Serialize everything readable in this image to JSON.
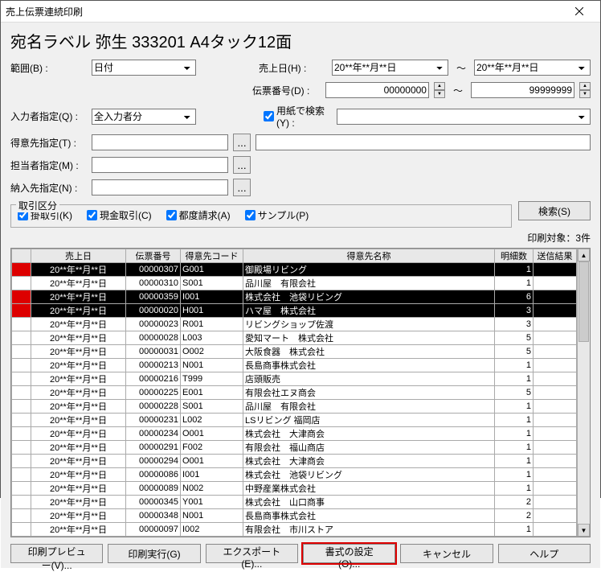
{
  "title": "売上伝票連続印刷",
  "heading": "宛名ラベル 弥生 333201 A4タック12面",
  "labels": {
    "range": "範囲(B) :",
    "saleDate": "売上日(H) :",
    "slipNo": "伝票番号(D) :",
    "inputter": "入力者指定(Q) :",
    "paperSearch": "用紙で検索(Y) :",
    "customer": "得意先指定(T) :",
    "person": "担当者指定(M) :",
    "delivery": "納入先指定(N) :"
  },
  "values": {
    "range": "日付",
    "dateFrom": "20**年**月**日",
    "dateTo": "20**年**月**日",
    "slipFrom": "00000000",
    "slipTo": "99999999",
    "inputter": "全入力者分"
  },
  "fieldset": {
    "legend": "取引区分",
    "kake": "掛取引(K)",
    "genkin": "現金取引(C)",
    "tsudo": "都度請求(A)",
    "sample": "サンプル(P)"
  },
  "searchBtn": "検索(S)",
  "countText": "印刷対象：3件",
  "columns": {
    "mark": "",
    "date": "売上日",
    "slip": "伝票番号",
    "custCode": "得意先コード",
    "custName": "得意先名称",
    "lines": "明細数",
    "result": "送信結果"
  },
  "rows": [
    {
      "sel": true,
      "date": "20**年**月**日",
      "slip": "00000307",
      "code": "G001",
      "name": "御殿場リビング",
      "lines": "1"
    },
    {
      "sel": false,
      "date": "20**年**月**日",
      "slip": "00000310",
      "code": "S001",
      "name": "品川屋　有限会社",
      "lines": "1"
    },
    {
      "sel": true,
      "date": "20**年**月**日",
      "slip": "00000359",
      "code": "I001",
      "name": "株式会社　池袋リビング",
      "lines": "6"
    },
    {
      "sel": true,
      "date": "20**年**月**日",
      "slip": "00000020",
      "code": "H001",
      "name": "ハマ屋　株式会社",
      "lines": "3"
    },
    {
      "sel": false,
      "date": "20**年**月**日",
      "slip": "00000023",
      "code": "R001",
      "name": "リビングショップ佐渡",
      "lines": "3"
    },
    {
      "sel": false,
      "date": "20**年**月**日",
      "slip": "00000028",
      "code": "L003",
      "name": "愛知マート　株式会社",
      "lines": "5"
    },
    {
      "sel": false,
      "date": "20**年**月**日",
      "slip": "00000031",
      "code": "O002",
      "name": "大阪食器　株式会社",
      "lines": "5"
    },
    {
      "sel": false,
      "date": "20**年**月**日",
      "slip": "00000213",
      "code": "N001",
      "name": "長島商事株式会社",
      "lines": "1"
    },
    {
      "sel": false,
      "date": "20**年**月**日",
      "slip": "00000216",
      "code": "T999",
      "name": "店頭販売",
      "lines": "1"
    },
    {
      "sel": false,
      "date": "20**年**月**日",
      "slip": "00000225",
      "code": "E001",
      "name": "有限会社エヌ商会",
      "lines": "5"
    },
    {
      "sel": false,
      "date": "20**年**月**日",
      "slip": "00000228",
      "code": "S001",
      "name": "品川屋　有限会社",
      "lines": "1"
    },
    {
      "sel": false,
      "date": "20**年**月**日",
      "slip": "00000231",
      "code": "L002",
      "name": "LSリビング 福岡店",
      "lines": "1"
    },
    {
      "sel": false,
      "date": "20**年**月**日",
      "slip": "00000234",
      "code": "O001",
      "name": "株式会社　大津商会",
      "lines": "1"
    },
    {
      "sel": false,
      "date": "20**年**月**日",
      "slip": "00000291",
      "code": "F002",
      "name": "有限会社　福山商店",
      "lines": "1"
    },
    {
      "sel": false,
      "date": "20**年**月**日",
      "slip": "00000294",
      "code": "O001",
      "name": "株式会社　大津商会",
      "lines": "1"
    },
    {
      "sel": false,
      "date": "20**年**月**日",
      "slip": "00000086",
      "code": "I001",
      "name": "株式会社　池袋リビング",
      "lines": "1"
    },
    {
      "sel": false,
      "date": "20**年**月**日",
      "slip": "00000089",
      "code": "N002",
      "name": "中野産業株式会社",
      "lines": "1"
    },
    {
      "sel": false,
      "date": "20**年**月**日",
      "slip": "00000345",
      "code": "Y001",
      "name": "株式会社　山口商事",
      "lines": "2"
    },
    {
      "sel": false,
      "date": "20**年**月**日",
      "slip": "00000348",
      "code": "N001",
      "name": "長島商事株式会社",
      "lines": "2"
    },
    {
      "sel": false,
      "date": "20**年**月**日",
      "slip": "00000097",
      "code": "I002",
      "name": "有限会社　市川ストア",
      "lines": "1"
    }
  ],
  "buttons": {
    "preview": "印刷プレビュー(V)...",
    "print": "印刷実行(G)",
    "export": "エクスポート(E)...",
    "format": "書式の設定(O)...",
    "cancel": "キャンセル",
    "help": "ヘルプ"
  }
}
